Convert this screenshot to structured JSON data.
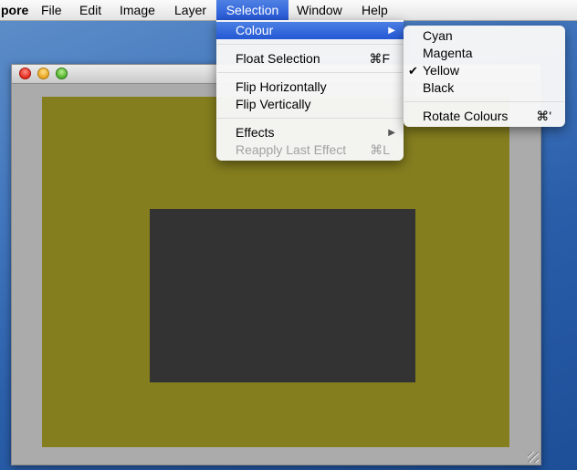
{
  "menubar": {
    "app": "pore",
    "file": "File",
    "edit": "Edit",
    "image": "Image",
    "layer": "Layer",
    "selection": "Selection",
    "window": "Window",
    "help": "Help"
  },
  "canvas": {
    "background_color": "#857e1f",
    "rect_color": "#333333"
  },
  "selection_menu": {
    "colour": "Colour",
    "float_selection": "Float Selection",
    "float_shortcut": "⌘F",
    "flip_h": "Flip Horizontally",
    "flip_v": "Flip Vertically",
    "effects": "Effects",
    "reapply": "Reapply Last Effect",
    "reapply_shortcut": "⌘L"
  },
  "colour_submenu": {
    "cyan": "Cyan",
    "magenta": "Magenta",
    "yellow": "Yellow",
    "black": "Black",
    "checked": "Yellow",
    "check_mark": "✔",
    "rotate": "Rotate Colours",
    "rotate_shortcut": "⌘'"
  }
}
